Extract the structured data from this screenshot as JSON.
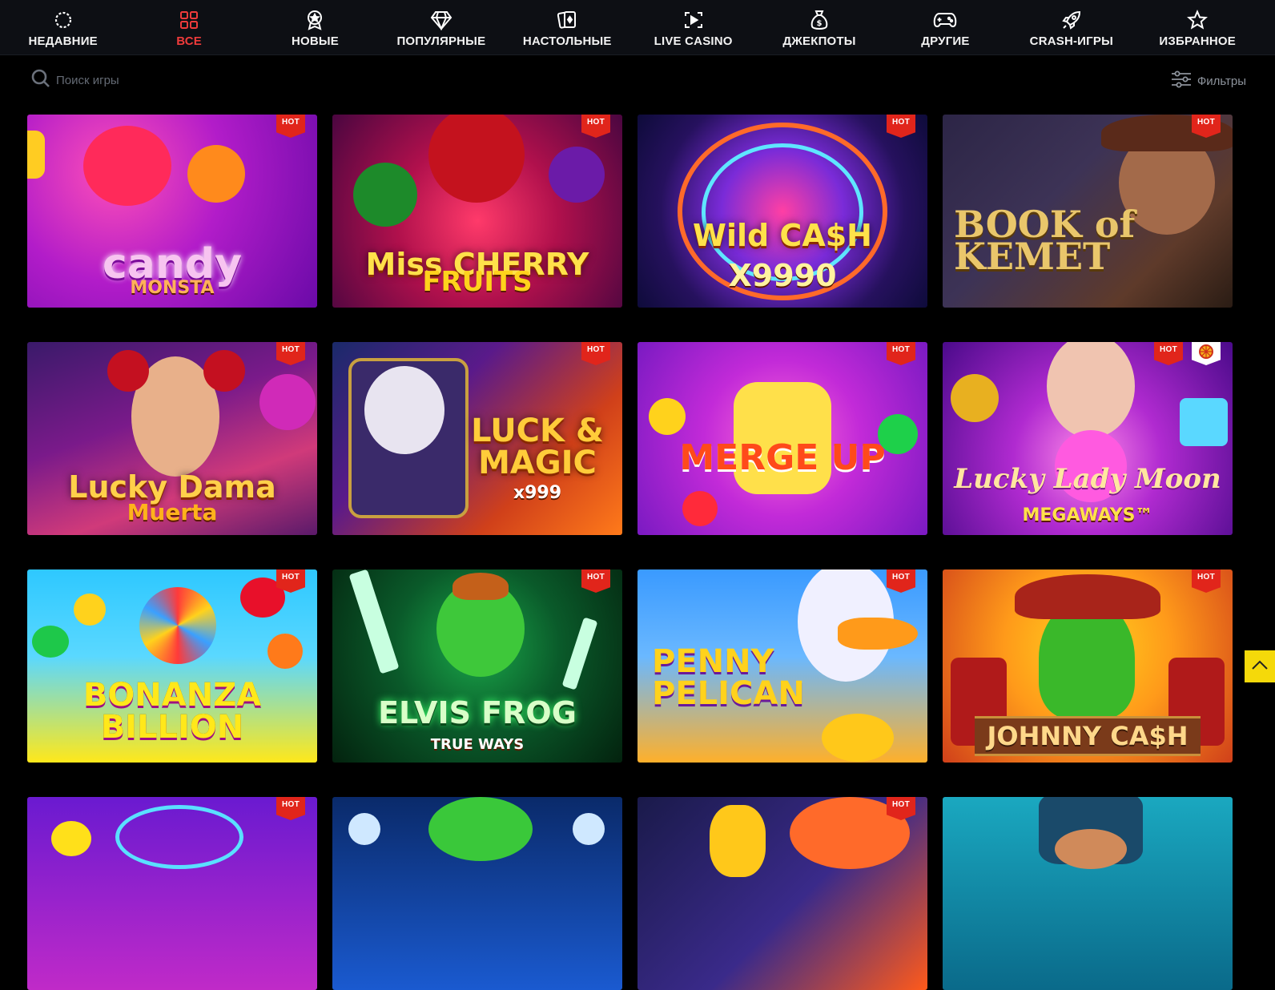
{
  "nav": {
    "items": [
      {
        "label": "НЕДАВНИЕ",
        "icon": "recent-icon"
      },
      {
        "label": "ВСЕ",
        "icon": "grid-icon"
      },
      {
        "label": "НОВЫЕ",
        "icon": "new-badge-icon"
      },
      {
        "label": "ПОПУЛЯРНЫЕ",
        "icon": "diamond-icon"
      },
      {
        "label": "НАСТОЛЬНЫЕ",
        "icon": "cards-icon"
      },
      {
        "label": "LIVE CASINO",
        "icon": "live-play-icon"
      },
      {
        "label": "ДЖЕКПОТЫ",
        "icon": "money-bag-icon"
      },
      {
        "label": "ДРУГИЕ",
        "icon": "gamepad-icon"
      },
      {
        "label": "CRASH-ИГРЫ",
        "icon": "rocket-icon"
      },
      {
        "label": "ИЗБРАННОЕ",
        "icon": "star-icon"
      }
    ],
    "active_index": 1,
    "active_color": "#ee3b3b"
  },
  "search": {
    "placeholder": "Поиск игры"
  },
  "filters": {
    "label": "Фильтры"
  },
  "badge": {
    "hot_label": "HOT",
    "hot_color": "#e1251b"
  },
  "games": [
    {
      "title": "candy",
      "subtitle": "MONSTA",
      "hot": true
    },
    {
      "title": "Miss CHERRY",
      "subtitle": "FRUITS",
      "hot": true
    },
    {
      "title": "Wild CA$H",
      "subtitle": "X9990",
      "hot": true
    },
    {
      "title": "BOOK of KEMET",
      "subtitle": "",
      "hot": true
    },
    {
      "title": "Lucky Dama",
      "subtitle": "Muerta",
      "hot": true
    },
    {
      "title": "LUCK & MAGIC",
      "subtitle": "x999",
      "hot": true
    },
    {
      "title": "MERGE UP",
      "subtitle": "",
      "hot": true
    },
    {
      "title": "Lucky Lady Moon",
      "subtitle": "MEGAWAYS™",
      "hot": true,
      "extra_badge": "wheel-icon"
    },
    {
      "title": "BONANZA BILLION",
      "subtitle": "",
      "hot": true
    },
    {
      "title": "ELVIS FROG",
      "subtitle": "TRUE WAYS",
      "hot": true
    },
    {
      "title": "PENNY PELICAN",
      "subtitle": "",
      "hot": true
    },
    {
      "title": "JOHNNY CA$H",
      "subtitle": "",
      "hot": true
    },
    {
      "title": "",
      "subtitle": "",
      "hot": true
    },
    {
      "title": "",
      "subtitle": "",
      "hot": false
    },
    {
      "title": "",
      "subtitle": "",
      "hot": true
    },
    {
      "title": "",
      "subtitle": "",
      "hot": false
    }
  ],
  "scroll_top": {
    "icon": "chevron-up-icon",
    "color": "#f5d90a"
  }
}
